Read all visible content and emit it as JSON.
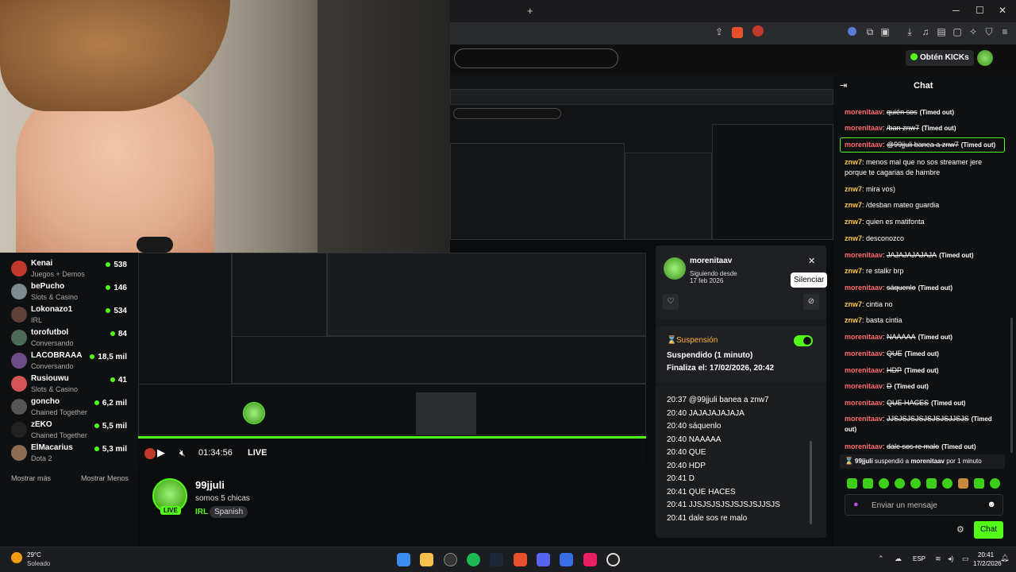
{
  "browser": {
    "new_tab": "+",
    "kick_button": "Obtén KICKs"
  },
  "window": {
    "minimize": "─",
    "maximize": "☐",
    "close": "✕"
  },
  "sidebar": {
    "channels": [
      {
        "name": "Kenai",
        "category": "Juegos + Demos",
        "viewers": "538",
        "color": "#c0392b"
      },
      {
        "name": "bePucho",
        "category": "Slots & Casino",
        "viewers": "146",
        "color": "#7f8c8d"
      },
      {
        "name": "Lokonazo1",
        "category": "IRL",
        "viewers": "534",
        "color": "#5d4037"
      },
      {
        "name": "torofutbol",
        "category": "Conversando",
        "viewers": "84",
        "color": "#4e6b5a"
      },
      {
        "name": "LACOBRAAA",
        "category": "Conversando",
        "viewers": "18,5 mil",
        "color": "#6d4c8a"
      },
      {
        "name": "Rusiouwu",
        "category": "Slots & Casino",
        "viewers": "41",
        "color": "#d35454"
      },
      {
        "name": "goncho",
        "category": "Chained Together",
        "viewers": "6,2 mil",
        "color": "#555"
      },
      {
        "name": "zEKO",
        "category": "Chained Together",
        "viewers": "5,5 mil",
        "color": "#222"
      },
      {
        "name": "ElMacarius",
        "category": "Dota 2",
        "viewers": "5,3 mil",
        "color": "#8e6e53"
      }
    ],
    "show_more": "Mostrar más",
    "show_less": "Mostrar Menos"
  },
  "player": {
    "time": "01:34:56",
    "live": "LIVE",
    "progress": 1.0
  },
  "stream": {
    "username": "99jjuli",
    "title": "somos 5 chicas",
    "category": "IRL",
    "language": "Spanish",
    "live_badge": "LIVE"
  },
  "usercard": {
    "username": "morenitaav",
    "following_label": "Siguiendo desde",
    "following_date": "17 feb 2026",
    "tooltip": "Silenciar",
    "suspension_title": "Suspensión",
    "suspended_line": "Suspendido (1 minuto)",
    "ends_line": "Finaliza el: 17/02/2026, 20:42",
    "toggle_on": true,
    "log": [
      "20:37 @99jjuli banea a znw7",
      "20:40 JAJAJAJAJAJA",
      "20:40 sáquenlo",
      "20:40 NAAAAA",
      "20:40 QUE",
      "20:40 HDP",
      "20:41 D",
      "20:41 QUE HACES",
      "20:41 JJSJSJSJSJSJSJSJJSJS",
      "20:41 dale sos re malo"
    ]
  },
  "chat": {
    "title": "Chat",
    "messages": [
      {
        "user": "morenitaav",
        "text": "quién sos",
        "timed_out": "(Timed out)",
        "strike": true,
        "color": "#ff6b6b"
      },
      {
        "user": "morenitaav",
        "text": "/ban znw7",
        "timed_out": "(Timed out)",
        "strike": true,
        "color": "#ff6b6b"
      },
      {
        "user": "morenitaav",
        "text": "@99jjuli banea a znw7",
        "timed_out": "(Timed out)",
        "strike": true,
        "color": "#ff6b6b"
      },
      {
        "user": "znw7",
        "text": "menos mal que no sos streamer jere porque te cagarias de hambre",
        "timed_out": "",
        "strike": false,
        "color": "#ffc94d"
      },
      {
        "user": "znw7",
        "text": "mira vos)",
        "timed_out": "",
        "strike": false,
        "color": "#ffc94d"
      },
      {
        "user": "znw7",
        "text": "/desban mateo guardia",
        "timed_out": "",
        "strike": false,
        "color": "#ffc94d"
      },
      {
        "user": "znw7",
        "text": "quien es matifonta",
        "timed_out": "",
        "strike": false,
        "color": "#ffc94d"
      },
      {
        "user": "znw7",
        "text": "desconozco",
        "timed_out": "",
        "strike": false,
        "color": "#ffc94d"
      },
      {
        "user": "morenitaav",
        "text": "JAJAJAJAJAJA",
        "timed_out": "(Timed out)",
        "strike": true,
        "color": "#ff6b6b"
      },
      {
        "user": "znw7",
        "text": "re stalkr brp",
        "timed_out": "",
        "strike": false,
        "color": "#ffc94d"
      },
      {
        "user": "morenitaav",
        "text": "sáquenlo",
        "timed_out": "(Timed out)",
        "strike": true,
        "color": "#ff6b6b"
      },
      {
        "user": "znw7",
        "text": "cintia no",
        "timed_out": "",
        "strike": false,
        "color": "#ffc94d"
      },
      {
        "user": "znw7",
        "text": "basta cintia",
        "timed_out": "",
        "strike": false,
        "color": "#ffc94d"
      },
      {
        "user": "morenitaav",
        "text": "NAAAAA",
        "timed_out": "(Timed out)",
        "strike": true,
        "color": "#ff6b6b"
      },
      {
        "user": "morenitaav",
        "text": "QUE",
        "timed_out": "(Timed out)",
        "strike": true,
        "color": "#ff6b6b"
      },
      {
        "user": "morenitaav",
        "text": "HDP",
        "timed_out": "(Timed out)",
        "strike": true,
        "color": "#ff6b6b"
      },
      {
        "user": "morenitaav",
        "text": "D",
        "timed_out": "(Timed out)",
        "strike": true,
        "color": "#ff6b6b"
      },
      {
        "user": "morenitaav",
        "text": "QUE HACES",
        "timed_out": "(Timed out)",
        "strike": true,
        "color": "#ff6b6b"
      },
      {
        "user": "morenitaav",
        "text": "JJSJSJSJSJSJSJSJJSJS",
        "timed_out": "(Timed out)",
        "strike": true,
        "color": "#ff6b6b"
      },
      {
        "user": "morenitaav",
        "text": "dale sos re malo",
        "timed_out": "(Timed out)",
        "strike": true,
        "color": "#ff6b6b"
      }
    ],
    "mod_notice_user": "99jjuli",
    "mod_notice_mid": "suspendió a",
    "mod_notice_target": "morenitaav",
    "mod_notice_tail": "por 1 minuto",
    "input_placeholder": "Enviar un mensaje",
    "send_label": "Chat"
  },
  "taskbar": {
    "weather_temp": "29°C",
    "weather_desc": "Soleado",
    "lang": "ESP",
    "time": "20:41",
    "date": "17/2/2026"
  },
  "colors": {
    "accent": "#53fc18",
    "chip": "#2f3033"
  }
}
